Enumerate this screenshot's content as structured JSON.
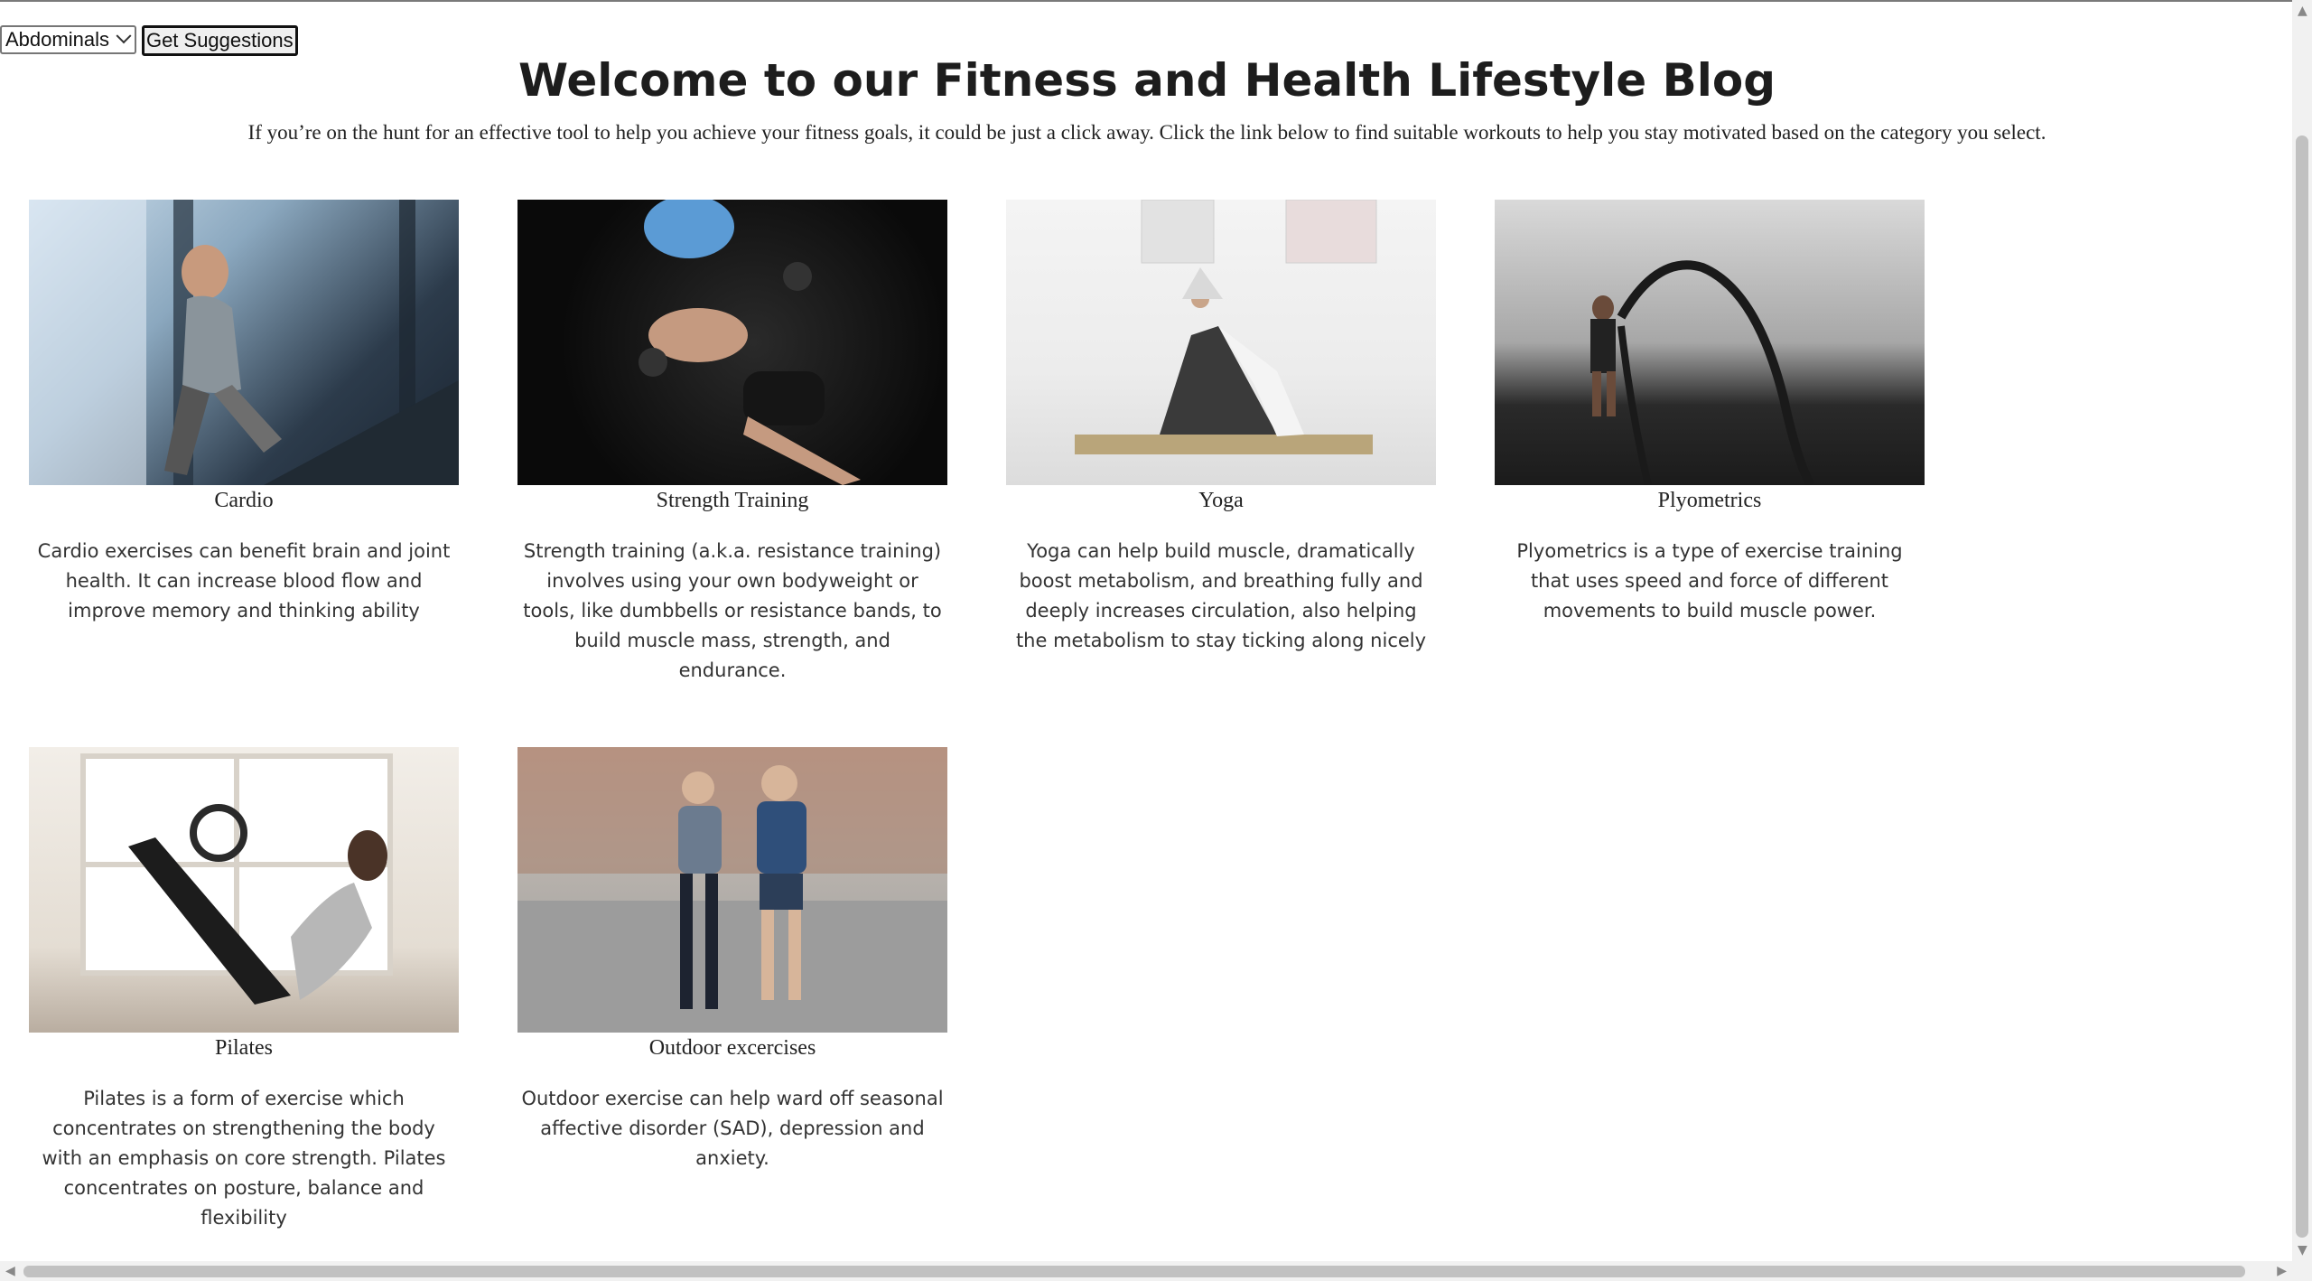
{
  "controls": {
    "category_select": "Abdominals",
    "suggest_button": "Get Suggestions"
  },
  "page": {
    "title": "Welcome to our Fitness and Health Lifestyle Blog",
    "intro": "If you’re on the hunt for an effective tool to help you achieve your fitness goals, it could be just a click away. Click the link below to find suitable workouts to help you stay motivated based on the category you select."
  },
  "cards": [
    {
      "title": "Cardio",
      "text": "Cardio exercises can benefit brain and joint health. It can increase blood flow and improve memory and thinking ability"
    },
    {
      "title": "Strength Training",
      "text": "Strength training (a.k.a. resistance training) involves using your own bodyweight or tools, like dumbbells or resistance bands, to build muscle mass, strength, and endurance."
    },
    {
      "title": "Yoga",
      "text": "Yoga can help build muscle, dramatically boost metabolism, and breathing fully and deeply increases circulation, also helping the metabolism to stay ticking along nicely"
    },
    {
      "title": "Plyometrics",
      "text": "Plyometrics is a type of exercise training that uses speed and force of different movements to build muscle power."
    },
    {
      "title": "Pilates",
      "text": "Pilates is a form of exercise which concentrates on strengthening the body with an emphasis on core strength. Pilates concentrates on posture, balance and flexibility"
    },
    {
      "title": "Outdoor excercises",
      "text": "Outdoor exercise can help ward off seasonal affective disorder (SAD), depression and anxiety."
    }
  ]
}
